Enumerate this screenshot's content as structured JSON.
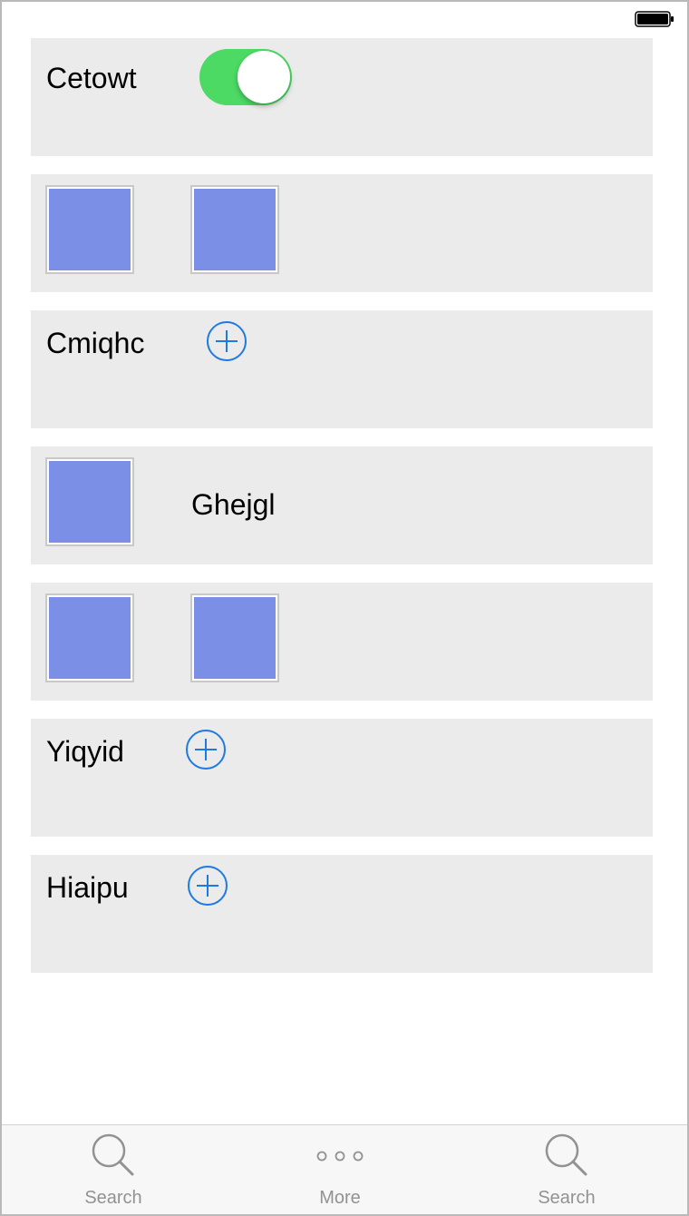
{
  "status_bar": {
    "battery_icon": "battery-icon"
  },
  "rows": {
    "r1": {
      "label": "Cetowt",
      "toggle_on": true
    },
    "r3": {
      "label": "Cmiqhc"
    },
    "r4": {
      "label": "Ghejgl"
    },
    "r6": {
      "label": "Yiqyid"
    },
    "r7": {
      "label": "Hiaipu"
    }
  },
  "tabbar": {
    "items": [
      {
        "label": "Search",
        "icon": "search-icon"
      },
      {
        "label": "More",
        "icon": "more-icon"
      },
      {
        "label": "Search",
        "icon": "search-icon"
      }
    ]
  },
  "colors": {
    "row_bg": "#ebebeb",
    "toggle_on": "#4cd964",
    "accent_blue": "#1f7ae0",
    "image_placeholder": "#7a8fe5",
    "tab_inactive": "#929292"
  }
}
